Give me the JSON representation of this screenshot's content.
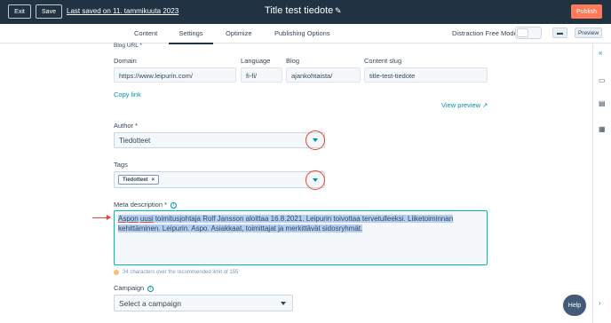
{
  "topbar": {
    "exit_label": "Exit",
    "save_label": "Save",
    "last_saved": "Last saved on 11. tammikuuta 2023",
    "title": "Title test tiedote",
    "publish_label": "Publish"
  },
  "tabs": [
    {
      "label": "Content",
      "active": false
    },
    {
      "label": "Settings",
      "active": true
    },
    {
      "label": "Optimize",
      "active": false
    },
    {
      "label": "Publishing Options",
      "active": false
    }
  ],
  "toolbar": {
    "distraction_free_label": "Distraction Free Mode",
    "preview_label": "Preview"
  },
  "blog_url": {
    "heading": "Blog URL *",
    "domain_label": "Domain",
    "domain_value": "https://www.leipurin.com/",
    "language_label": "Language",
    "language_value": "fi-fi/",
    "blog_label": "Blog",
    "blog_value": "ajankohtaista/",
    "slug_label": "Content slug",
    "slug_value": "title-test-tiedote",
    "copy_link": "Copy link",
    "view_preview": "View preview"
  },
  "author": {
    "label": "Author *",
    "value": "Tiedotteet"
  },
  "tags": {
    "label": "Tags",
    "chip": "Tiedotteet"
  },
  "meta": {
    "label": "Meta description *",
    "text_part1": "Aspon",
    "text_part2": " ",
    "text_part3": "uusi",
    "text_part4": " toimitusjohtaja Rolf Jansson aloittaa 16.8.2021. Leipurin toivottaa tervetulleeksi. Liiketoiminnan kehittäminen. Leipurin. Aspo. Asiakkaat, toimittajat ja merkittävät sidosryhmät.",
    "warning": "34 characters over the recommended limit of 155"
  },
  "campaign": {
    "label": "Campaign",
    "placeholder": "Select a campaign"
  },
  "help_label": "Help",
  "colors": {
    "topbar_bg": "#213343",
    "accent": "#ff7a59",
    "link": "#0091ae",
    "annotation": "#e8452c",
    "focus": "#00bda5"
  }
}
